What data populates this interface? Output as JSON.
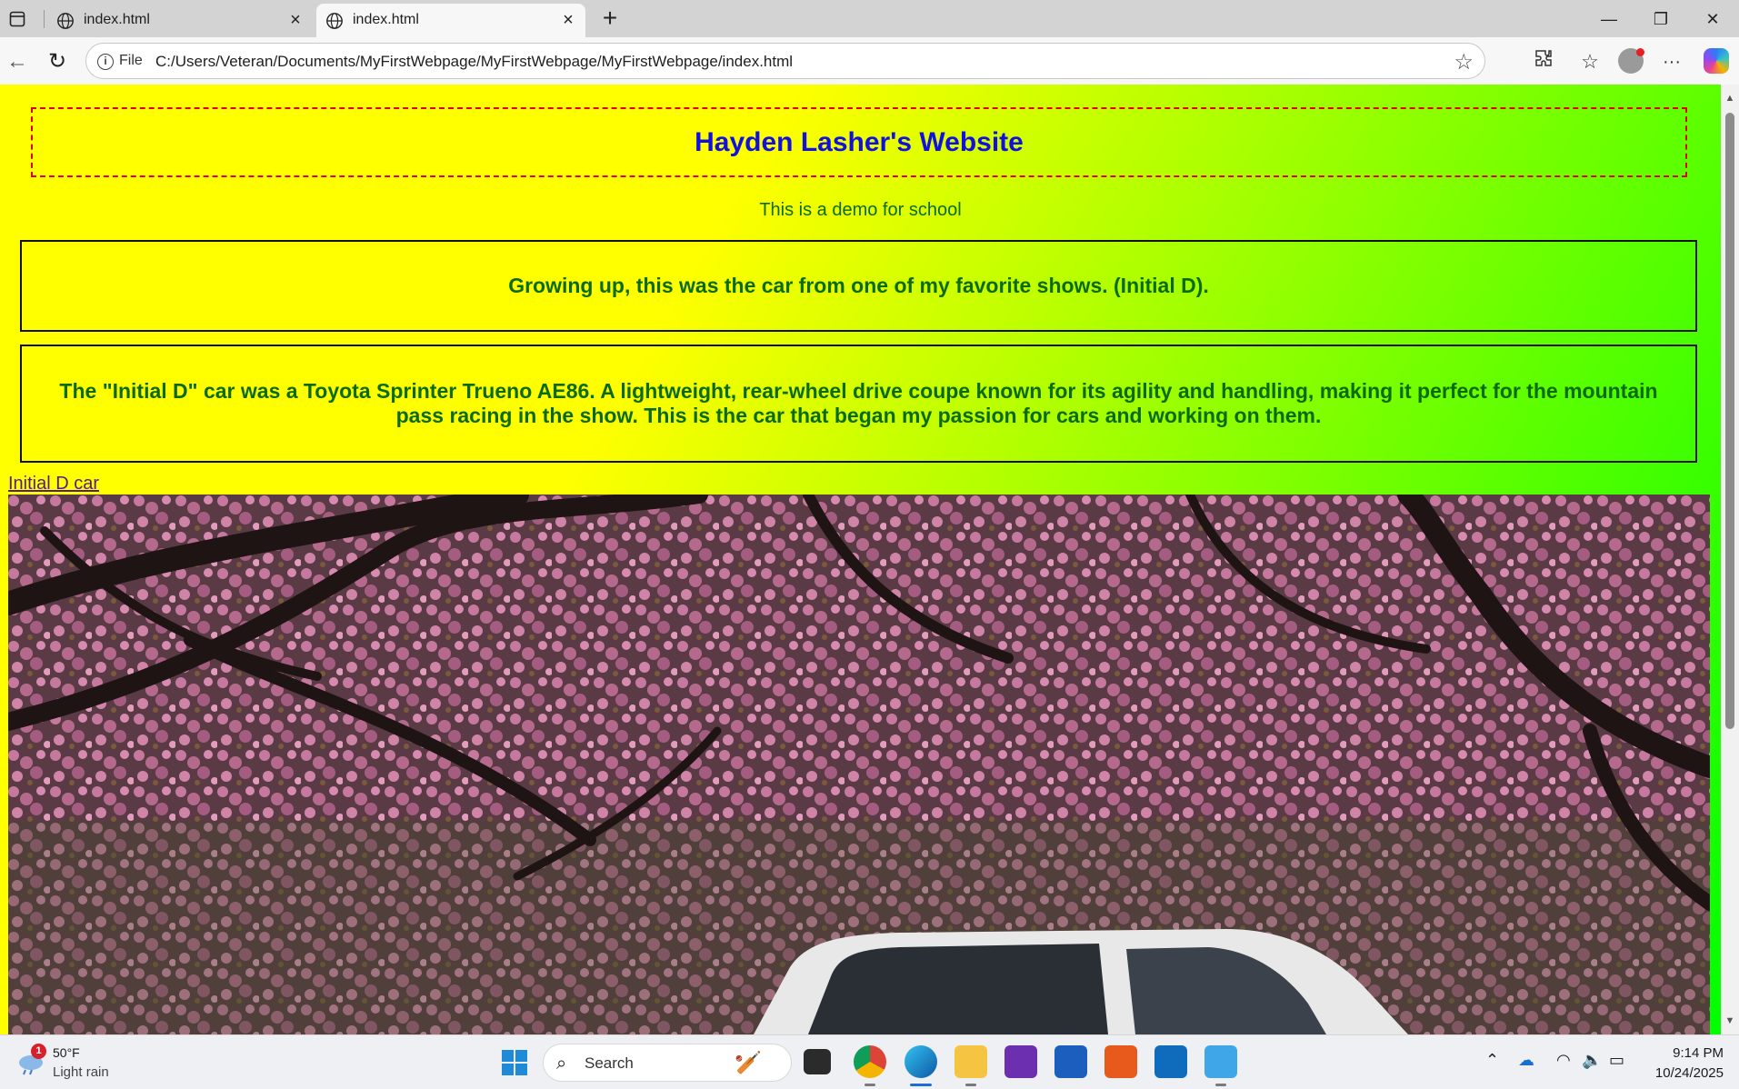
{
  "browser": {
    "tabs": [
      {
        "title": "index.html",
        "active": false
      },
      {
        "title": "index.html",
        "active": true
      }
    ],
    "new_tab_symbol": "+",
    "window_controls": {
      "minimize": "—",
      "maximize": "❐",
      "close": "✕"
    },
    "nav": {
      "back": "←",
      "reload": "↻"
    },
    "address": {
      "scheme_label": "File",
      "url": "C:/Users/Veteran/Documents/MyFirstWebpage/MyFirstWebpage/MyFirstWebpage/index.html"
    },
    "toolbar_icons": [
      "star-icon",
      "extensions-icon",
      "favorites-icon",
      "profile-avatar",
      "more-icon",
      "copilot-icon"
    ]
  },
  "page": {
    "title": "Hayden Lasher's Website",
    "subtitle": "This is a demo for school",
    "box1_text": "Growing up, this was the car from one of my favorite shows. (Initial D).",
    "box2_text": "The \"Initial D\" car was a Toyota Sprinter Trueno AE86. A lightweight, rear-wheel drive coupe known for its agility and handling, making it perfect for the mountain pass racing in the show. This is the car that began my passion for cars and working on them.",
    "image_link_text": "Initial D car",
    "colors": {
      "title": "#1010e0",
      "body_text": "#0b6b0b",
      "header_border": "#e0001a",
      "gradient_start": "#ffff00",
      "gradient_end": "#00ff00"
    }
  },
  "taskbar": {
    "weather": {
      "badge": "1",
      "temp": "50°F",
      "desc": "Light rain"
    },
    "search_placeholder": "Search",
    "apps": [
      "task-view-icon",
      "chrome-icon",
      "edge-icon",
      "file-explorer-icon",
      "photos-icon",
      "word-icon",
      "app-icon",
      "outlook-icon",
      "notepad-icon"
    ],
    "clock": {
      "time": "9:14 PM",
      "date": "10/24/2025"
    }
  }
}
